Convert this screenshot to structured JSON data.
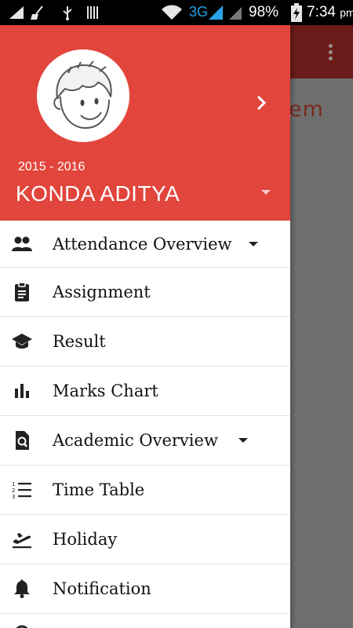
{
  "status_bar": {
    "network": "3G",
    "battery": "98%",
    "time": "7:34",
    "ampm": "pm"
  },
  "background_app": {
    "peek_text": "em"
  },
  "drawer": {
    "header": {
      "session": "2015 - 2016",
      "student_name": "KONDA ADITYA",
      "accent_color": "#e2453c"
    },
    "menu": [
      {
        "label": "Attendance Overview",
        "icon": "group-icon",
        "expandable": true
      },
      {
        "label": "Assignment",
        "icon": "clipboard-icon",
        "expandable": false
      },
      {
        "label": "Result",
        "icon": "graduation-cap-icon",
        "expandable": false
      },
      {
        "label": "Marks Chart",
        "icon": "bar-chart-icon",
        "expandable": false
      },
      {
        "label": "Academic Overview",
        "icon": "document-search-icon",
        "expandable": true
      },
      {
        "label": "Time Table",
        "icon": "numbered-list-icon",
        "expandable": false
      },
      {
        "label": "Holiday",
        "icon": "flight-takeoff-icon",
        "expandable": false
      },
      {
        "label": "Notification",
        "icon": "bell-icon",
        "expandable": false
      }
    ]
  }
}
